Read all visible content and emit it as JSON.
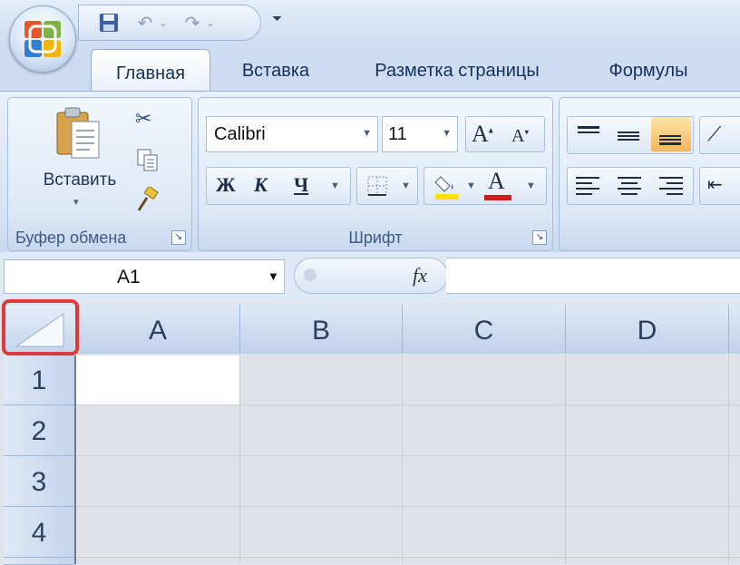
{
  "tabs": {
    "home": "Главная",
    "insert": "Вставка",
    "page_layout": "Разметка страницы",
    "formulas": "Формулы"
  },
  "clipboard": {
    "paste_label": "Вставить",
    "group_label": "Буфер обмена"
  },
  "font": {
    "name": "Calibri",
    "size": "11",
    "bold": "Ж",
    "italic": "К",
    "underline": "Ч",
    "group_label": "Шрифт"
  },
  "formula_bar": {
    "cell_ref": "A1",
    "fx_label": "fx"
  },
  "columns": [
    "A",
    "B",
    "C",
    "D"
  ],
  "rows": [
    "1",
    "2",
    "3",
    "4"
  ],
  "colors": {
    "highlight": "#e0393b",
    "font_color": "#d01b1b",
    "fill_color": "#ffe000",
    "accent_orange": "#f5b45c"
  }
}
